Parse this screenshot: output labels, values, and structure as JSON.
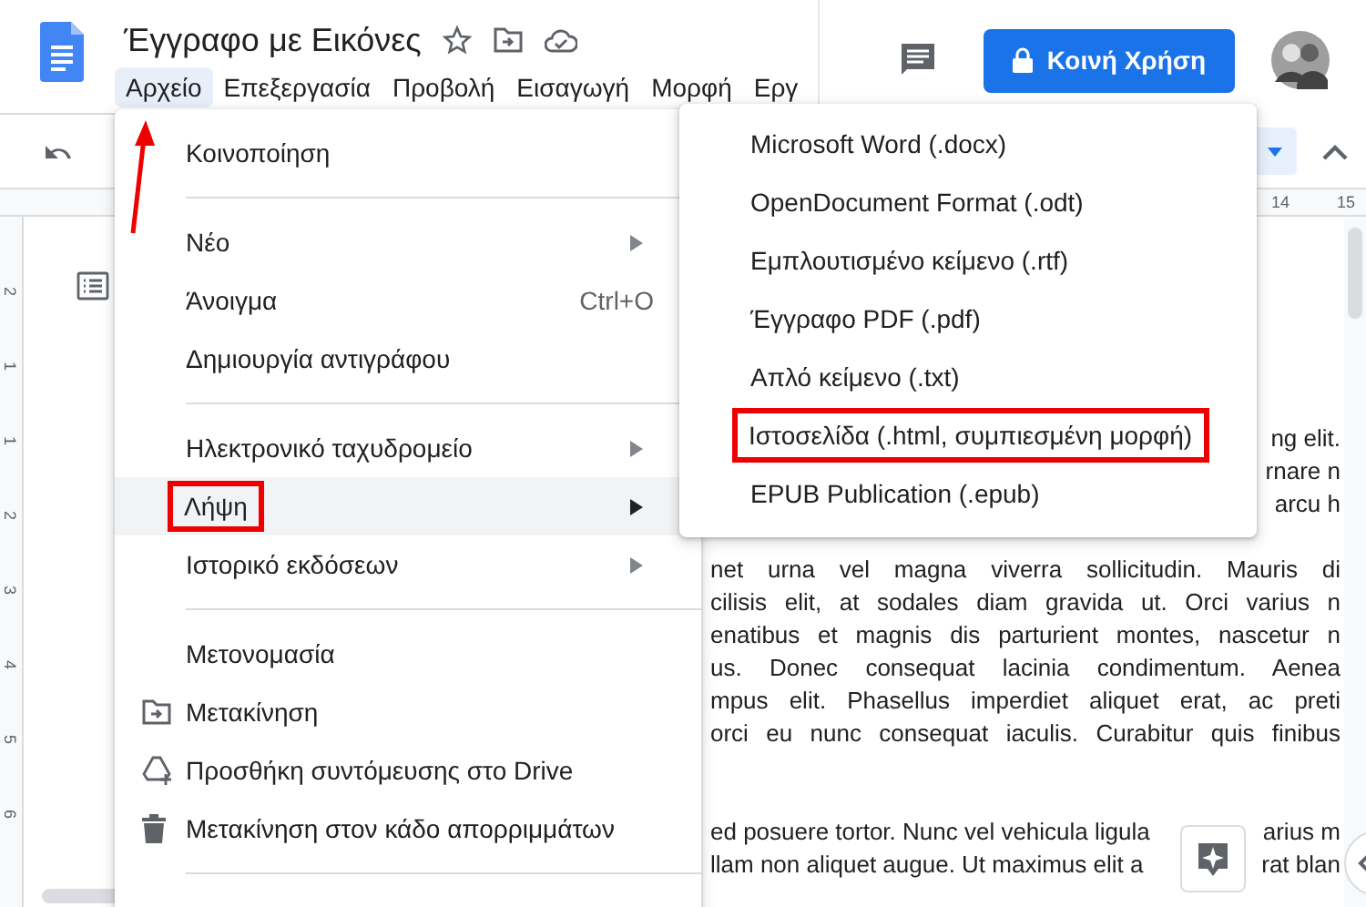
{
  "document": {
    "title": "Έγγραφο με Εικόνες"
  },
  "menubar": [
    {
      "label": "Αρχείο",
      "selected": true
    },
    {
      "label": "Επεξεργασία",
      "selected": false
    },
    {
      "label": "Προβολή",
      "selected": false
    },
    {
      "label": "Εισαγωγή",
      "selected": false
    },
    {
      "label": "Μορφή",
      "selected": false
    },
    {
      "label": "Εργ",
      "selected": false
    }
  ],
  "share_button": {
    "label": "Κοινή Χρήση"
  },
  "ruler": {
    "labels": [
      "14",
      "15"
    ]
  },
  "vertical_ruler": {
    "labels": [
      "2",
      "1",
      "1",
      "2",
      "3",
      "4",
      "5",
      "6"
    ]
  },
  "file_menu": {
    "items": [
      {
        "kind": "item",
        "label": "Κοινοποίηση",
        "has_submenu": false,
        "selected": false,
        "annotated": false
      },
      {
        "kind": "divider"
      },
      {
        "kind": "item",
        "label": "Νέο",
        "has_submenu": true,
        "selected": false,
        "annotated": false
      },
      {
        "kind": "item",
        "label": "Άνοιγμα",
        "shortcut": "Ctrl+O",
        "has_submenu": false,
        "selected": false,
        "annotated": false
      },
      {
        "kind": "item",
        "label": "Δημιουργία αντιγράφου",
        "has_submenu": false,
        "selected": false,
        "annotated": false
      },
      {
        "kind": "divider"
      },
      {
        "kind": "item",
        "label": "Ηλεκτρονικό ταχυδρομείο",
        "has_submenu": true,
        "selected": false,
        "annotated": false
      },
      {
        "kind": "item",
        "label": "Λήψη",
        "has_submenu": true,
        "selected": true,
        "annotated": true
      },
      {
        "kind": "item",
        "label": "Ιστορικό εκδόσεων",
        "has_submenu": true,
        "selected": false,
        "annotated": false
      },
      {
        "kind": "divider"
      },
      {
        "kind": "item",
        "label": "Μετονομασία",
        "has_submenu": false,
        "selected": false,
        "annotated": false
      },
      {
        "kind": "item",
        "label": "Μετακίνηση",
        "has_submenu": false,
        "selected": false,
        "annotated": false
      },
      {
        "kind": "item",
        "label": "Προσθήκη συντόμευσης στο Drive",
        "has_submenu": false,
        "selected": false,
        "annotated": false
      },
      {
        "kind": "item",
        "label": "Μετακίνηση στον κάδο απορριμμάτων",
        "has_submenu": false,
        "selected": false,
        "annotated": false
      },
      {
        "kind": "divider"
      }
    ]
  },
  "download_submenu": {
    "items": [
      {
        "label": "Microsoft Word (.docx)",
        "annotated": false
      },
      {
        "label": "OpenDocument Format (.odt)",
        "annotated": false
      },
      {
        "label": "Εμπλουτισμένο κείμενο (.rtf)",
        "annotated": false
      },
      {
        "label": "Έγγραφο PDF (.pdf)",
        "annotated": false
      },
      {
        "label": "Απλό κείμενο (.txt)",
        "annotated": false
      },
      {
        "label": "Ιστοσελίδα (.html, συμπιεσμένη μορφή)",
        "annotated": true
      },
      {
        "label": "EPUB Publication (.epub)",
        "annotated": false
      }
    ]
  },
  "page_text": [
    {
      "kind": "tail",
      "text": "ng elit."
    },
    {
      "kind": "tail",
      "text": "rnare n"
    },
    {
      "kind": "tail",
      "text": "arcu h"
    },
    {
      "kind": "gap"
    },
    {
      "kind": "full",
      "text": "net urna vel magna viverra sollicitudin. Mauris di"
    },
    {
      "kind": "full",
      "text": "cilisis elit, at sodales diam gravida ut. Orci varius n"
    },
    {
      "kind": "full",
      "text": "enatibus et magnis dis parturient montes, nascetur n"
    },
    {
      "kind": "full",
      "text": "us. Donec consequat lacinia condimentum. Aenea"
    },
    {
      "kind": "full",
      "text": "mpus elit. Phasellus imperdiet aliquet erat, ac preti"
    },
    {
      "kind": "full",
      "text": "orci eu nunc consequat iaculis. Curabitur quis finibus"
    },
    {
      "kind": "gap"
    },
    {
      "kind": "gap"
    },
    {
      "kind": "split",
      "text": "ed posuere tortor. Nunc vel vehicula ligula",
      "tail": "arius m"
    },
    {
      "kind": "split",
      "text": "llam non aliquet augue. Ut maximus elit a",
      "tail": "rat blan"
    }
  ]
}
